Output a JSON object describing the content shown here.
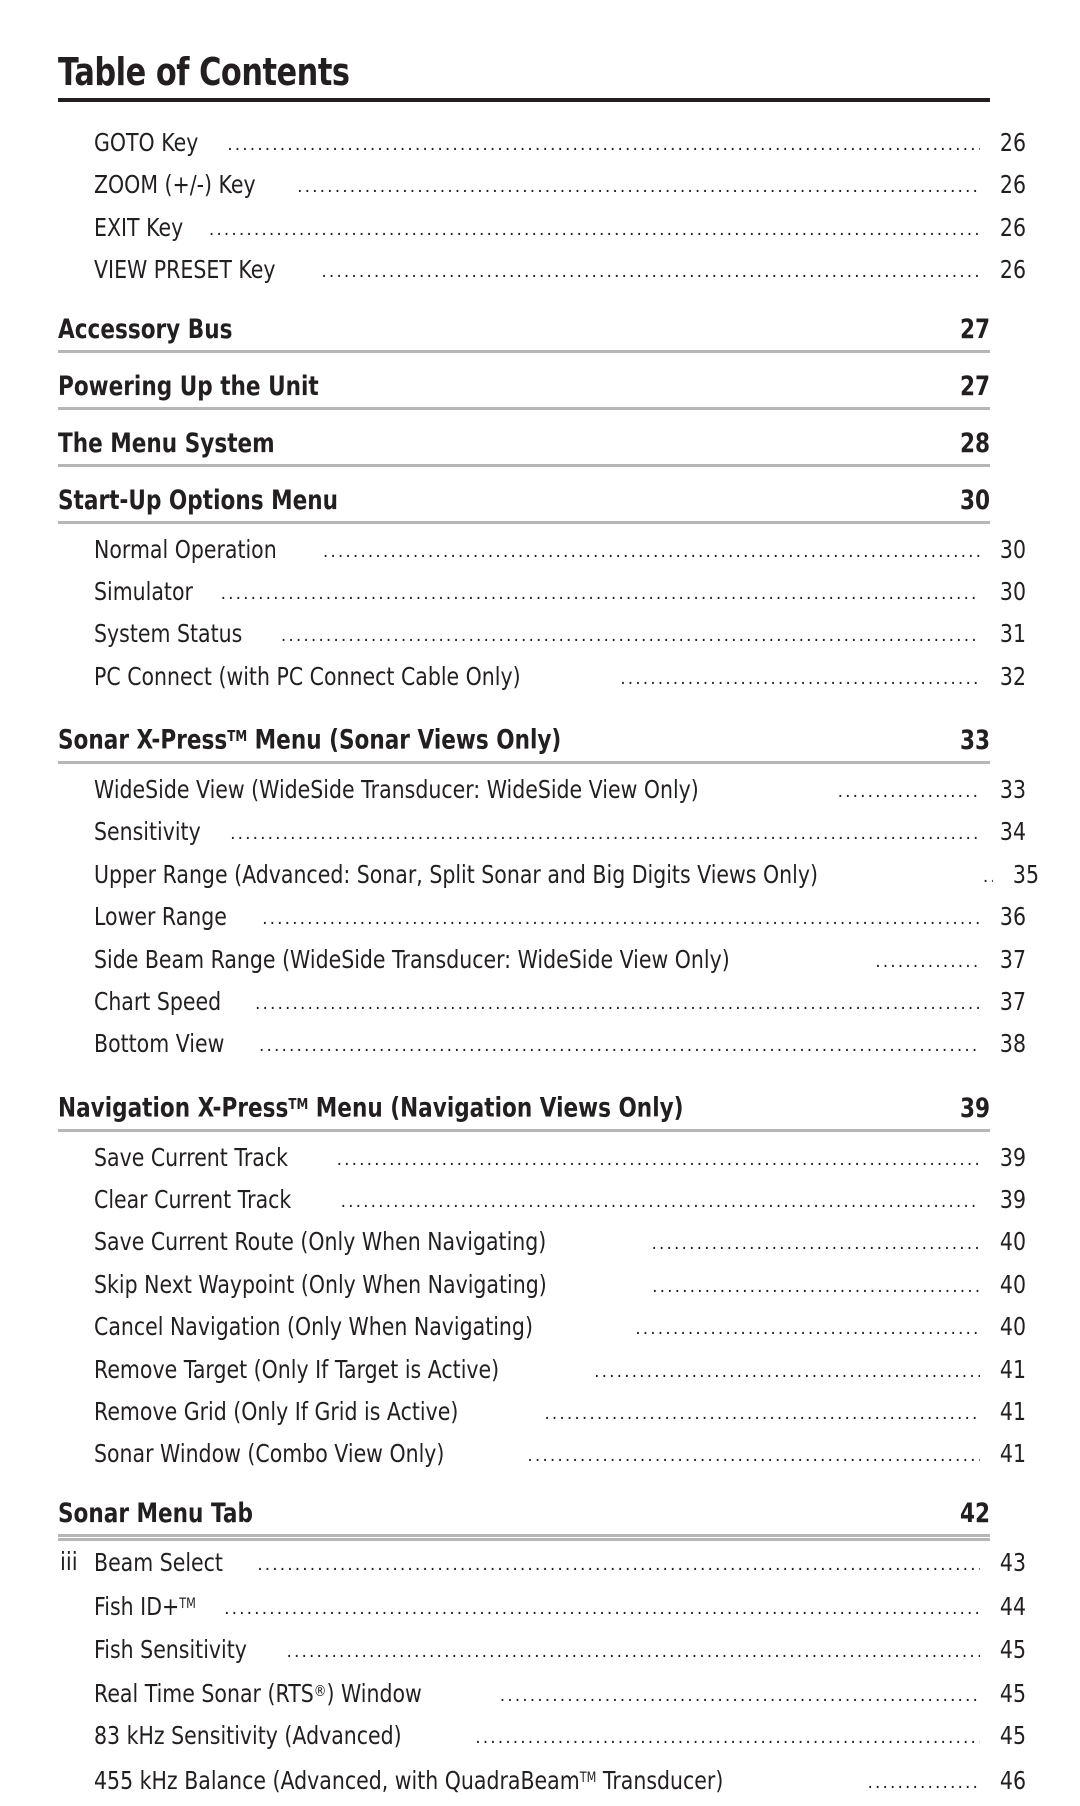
{
  "page": {
    "title": "Table of Contents",
    "footer_page_number": "iii"
  },
  "colors": {
    "text": "#231f20",
    "title_rule": "#231f20",
    "section_rule": "#b6b6b6",
    "background": "#ffffff"
  },
  "toc": {
    "blocks": [
      {
        "type": "entries",
        "entries": [
          {
            "label": "GOTO Key",
            "page": "26"
          },
          {
            "label": "ZOOM (+/-) Key",
            "page": "26"
          },
          {
            "label": "EXIT Key",
            "page": "26"
          },
          {
            "label": "VIEW PRESET Key",
            "page": "26"
          }
        ]
      },
      {
        "type": "section",
        "heading": {
          "label": "Accessory Bus",
          "page": "27"
        },
        "entries": []
      },
      {
        "type": "section",
        "heading": {
          "label": "Powering Up the Unit",
          "page": "27"
        },
        "entries": []
      },
      {
        "type": "section",
        "heading": {
          "label": "The Menu System",
          "page": "28"
        },
        "entries": []
      },
      {
        "type": "section",
        "heading": {
          "label": "Start-Up Options Menu",
          "page": "30"
        },
        "entries": [
          {
            "label": "Normal Operation",
            "page": "30"
          },
          {
            "label": "Simulator",
            "page": "30"
          },
          {
            "label": "System Status",
            "page": "31"
          },
          {
            "label": "PC Connect (with PC Connect Cable Only)",
            "page": "32"
          }
        ]
      },
      {
        "type": "section",
        "heading": {
          "label_html": "Sonar X-Press<sup class=\"tm\">TM</sup> Menu (Sonar Views Only)",
          "label": "Sonar X-Press™ Menu (Sonar Views Only)",
          "page": "33"
        },
        "entries": [
          {
            "label": "WideSide View (WideSide Transducer: WideSide View Only)",
            "page": "33"
          },
          {
            "label": "Sensitivity",
            "page": "34"
          },
          {
            "label": "Upper Range (Advanced: Sonar, Split Sonar and Big Digits Views Only)",
            "page": "35"
          },
          {
            "label": "Lower Range",
            "page": "36"
          },
          {
            "label": "Side Beam Range (WideSide Transducer: WideSide View Only)",
            "page": "37"
          },
          {
            "label": "Chart Speed",
            "page": "37"
          },
          {
            "label": "Bottom View",
            "page": "38"
          }
        ]
      },
      {
        "type": "section",
        "heading": {
          "label_html": "Navigation X-Press<sup class=\"tm\">TM</sup> Menu (Navigation Views Only)",
          "label": "Navigation X-Press™ Menu (Navigation Views Only)",
          "page": "39"
        },
        "entries": [
          {
            "label": "Save Current Track",
            "page": "39"
          },
          {
            "label": "Clear Current Track",
            "page": "39"
          },
          {
            "label": "Save Current Route (Only When Navigating)",
            "page": "40"
          },
          {
            "label": "Skip Next Waypoint (Only When Navigating)",
            "page": "40"
          },
          {
            "label": "Cancel Navigation (Only When Navigating)",
            "page": "40"
          },
          {
            "label": "Remove Target  (Only If Target is Active)",
            "page": "41"
          },
          {
            "label": "Remove Grid (Only If Grid is Active)",
            "page": "41"
          },
          {
            "label": "Sonar Window (Combo View Only)",
            "page": "41"
          }
        ]
      },
      {
        "type": "section",
        "heading": {
          "label": "Sonar Menu Tab",
          "page": "42"
        },
        "entries": [
          {
            "label": "Beam Select",
            "page": "43"
          },
          {
            "label_html": "Fish ID+<sup class=\"tm\">TM</sup>",
            "label": "Fish ID+™",
            "page": "44"
          },
          {
            "label": "Fish Sensitivity",
            "page": "45"
          },
          {
            "label_html": "Real Time Sonar (RTS<sup class=\"reg\">&#174;</sup>) Window",
            "label": "Real Time Sonar (RTS®) Window",
            "page": "45"
          },
          {
            "label": "83 kHz Sensitivity (Advanced)",
            "page": "45"
          },
          {
            "label_html": "455 kHz Balance (Advanced, with QuadraBeam<sup class=\"tm\">TM</sup> Transducer)",
            "label": "455 kHz Balance (Advanced, with QuadraBeam™ Transducer)",
            "page": "46"
          }
        ]
      }
    ]
  }
}
